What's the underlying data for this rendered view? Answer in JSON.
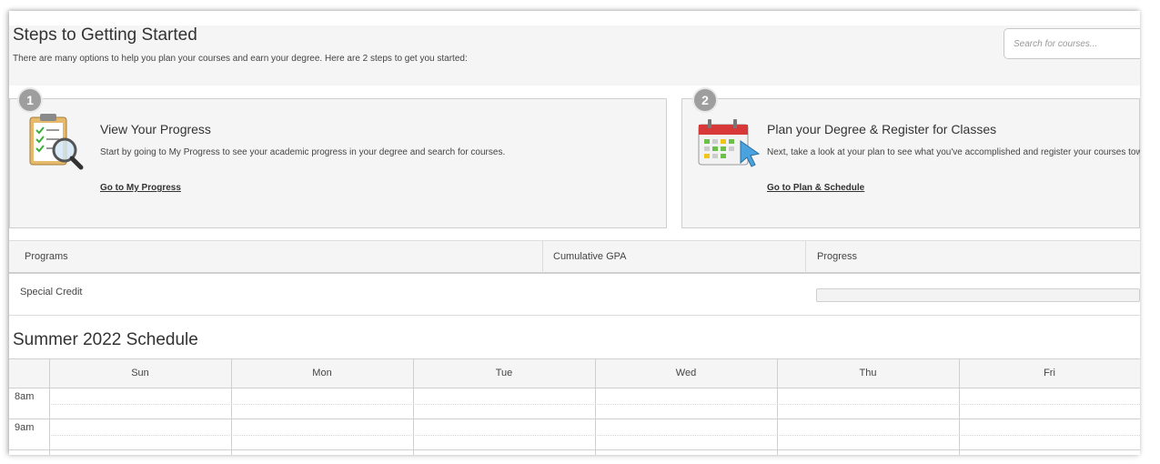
{
  "header": {
    "title": "Steps to Getting Started",
    "subtitle": "There are many options to help you plan your courses and earn your degree. Here are 2 steps to get you started:"
  },
  "search": {
    "placeholder": "Search for courses..."
  },
  "steps": [
    {
      "number": "1",
      "title": "View Your Progress",
      "description": "Start by going to My Progress to see your academic progress in your degree and search for courses.",
      "link": "Go to My Progress",
      "icon": "clipboard-magnifier-icon"
    },
    {
      "number": "2",
      "title": "Plan your Degree & Register for Classes",
      "description": "Next, take a look at your plan to see what you've accomplished and register your courses toward your degree.",
      "link": "Go to Plan & Schedule",
      "icon": "calendar-cursor-icon"
    }
  ],
  "programs": {
    "columns": [
      "Programs",
      "Cumulative GPA",
      "Progress"
    ],
    "rows": [
      {
        "name": "Special Credit",
        "gpa": "",
        "progress": 0
      }
    ]
  },
  "schedule": {
    "title": "Summer 2022 Schedule",
    "days": [
      "Sun",
      "Mon",
      "Tue",
      "Wed",
      "Thu",
      "Fri"
    ],
    "times": [
      "8am",
      "9am"
    ]
  },
  "colors": {
    "progress_fill": "#3a7bd5",
    "badge": "#9e9e9e",
    "panel": "#f5f5f5"
  }
}
